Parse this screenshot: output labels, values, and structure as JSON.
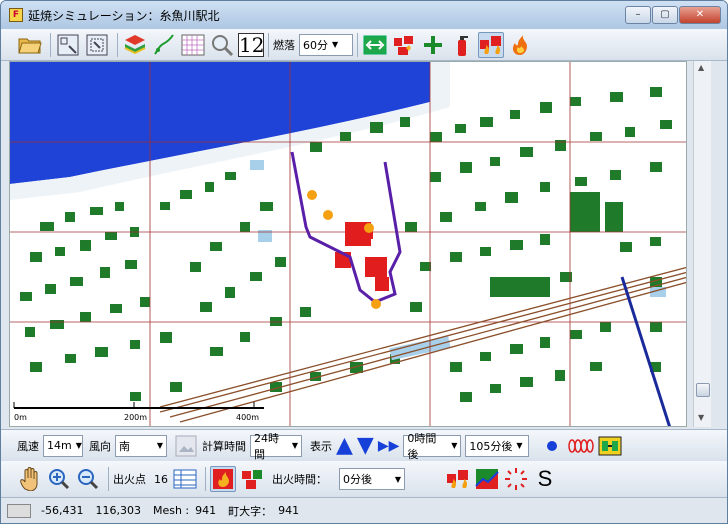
{
  "window": {
    "title": "延焼シミュレーション：糸魚川駅北",
    "minimize_label": "–",
    "maximize_label": "▢",
    "close_label": "✕"
  },
  "toolbar_top": {
    "burn_label": "燃落",
    "burn_select": "60分",
    "number_icon_label": "12"
  },
  "toolbar_middle": {
    "wind_speed_label": "風速",
    "wind_speed_value": "14m",
    "wind_dir_label": "風向",
    "wind_dir_value": "南",
    "calc_time_label": "計算時間",
    "calc_time_value": "24時間",
    "display_label": "表示",
    "time_after_value": "0時間後",
    "min_after_value": "105分後"
  },
  "toolbar_bottom": {
    "fire_points_label": "出火点",
    "fire_points_count": "16",
    "fire_time_label": "出火時間：",
    "fire_time_value": "0分後",
    "s_label": "S"
  },
  "map": {
    "scale_labels": [
      "0m",
      "200m",
      "400m"
    ],
    "colors": {
      "sea": "#1f43d6",
      "building": "#1f7a2a",
      "burning": "#e21d1d",
      "gridline": "#a03030",
      "rail": "#8b4f2a",
      "fire_boundary": "#5a1fa8"
    }
  },
  "status": {
    "x": "-56,431",
    "y": "116,303",
    "mesh_label": "Mesh :",
    "mesh_value": "941",
    "town_label": "町大字：",
    "town_value": "941"
  }
}
